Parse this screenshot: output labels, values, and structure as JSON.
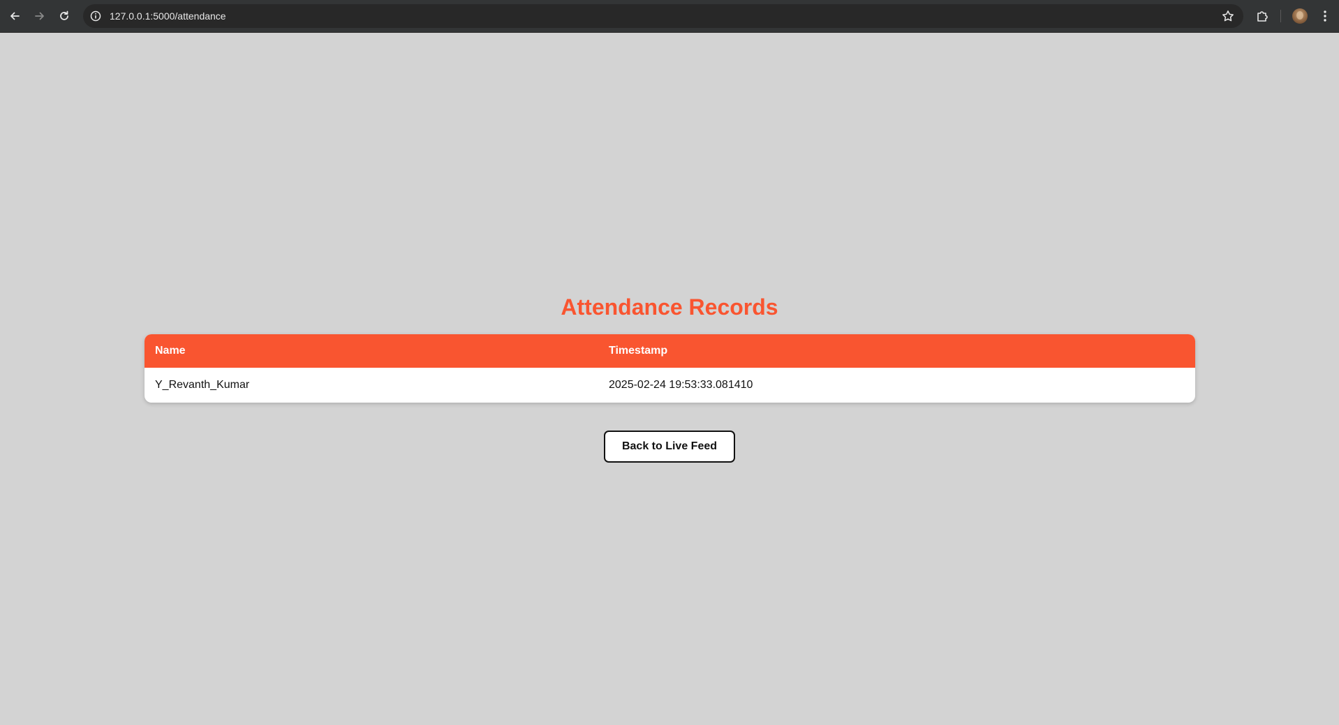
{
  "browser": {
    "url": "127.0.0.1:5000/attendance",
    "icons": [
      "back-arrow-icon",
      "forward-arrow-icon",
      "reload-icon",
      "info-icon",
      "star-icon",
      "extensions-icon",
      "profile-avatar",
      "kebab-menu-icon"
    ]
  },
  "page": {
    "title": "Attendance Records",
    "accent_color": "#f95530",
    "background_color": "#d3d3d3"
  },
  "table": {
    "columns": [
      "Name",
      "Timestamp"
    ],
    "rows": [
      [
        "Y_Revanth_Kumar",
        "2025-02-24 19:53:33.081410"
      ]
    ]
  },
  "actions": {
    "back_label": "Back to Live Feed"
  }
}
